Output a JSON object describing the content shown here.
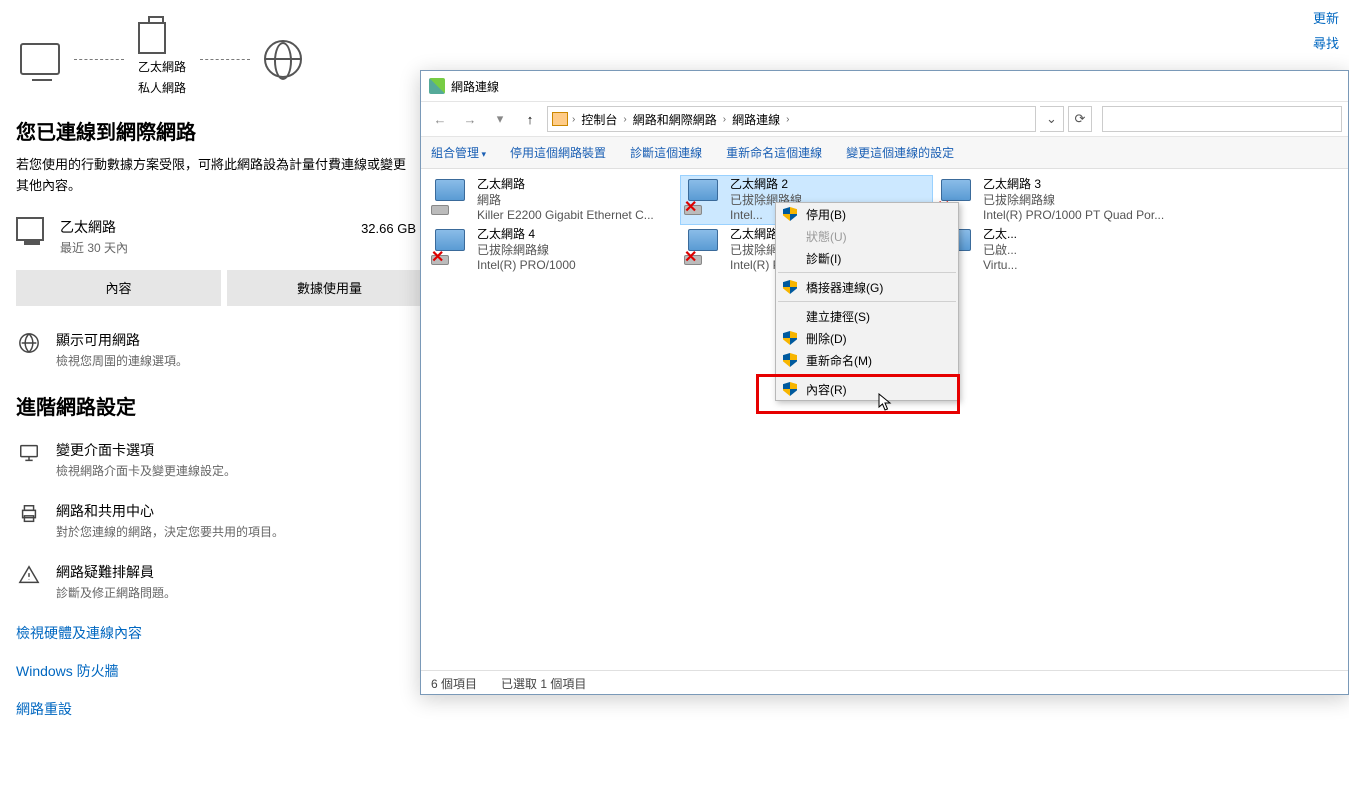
{
  "topLinks": {
    "update": "更新",
    "find": "尋找"
  },
  "diagram": {
    "router_label1": "乙太網路",
    "router_label2": "私人網路"
  },
  "settings": {
    "headline": "您已連線到網際網路",
    "sub": "若您使用的行動數據方案受限，可將此網路設為計量付費連線或變更其他內容。",
    "eth_name": "乙太網路",
    "eth_sub": "最近 30 天內",
    "eth_rate": "32.66 GB",
    "btn_properties": "內容",
    "btn_usage": "數據使用量",
    "opt_available_t": "顯示可用網路",
    "opt_available_s": "檢視您周圍的連線選項。",
    "adv_hdr": "進階網路設定",
    "opt_adapter_t": "變更介面卡選項",
    "opt_adapter_s": "檢視網路介面卡及變更連線設定。",
    "opt_sharing_t": "網路和共用中心",
    "opt_sharing_s": "對於您連線的網路，決定您要共用的項目。",
    "opt_trouble_t": "網路疑難排解員",
    "opt_trouble_s": "診斷及修正網路問題。",
    "link_hw": "檢視硬體及連線內容",
    "link_fw": "Windows 防火牆",
    "link_reset": "網路重設"
  },
  "window": {
    "title": "網路連線",
    "breadcrumb": [
      "控制台",
      "網路和網際網路",
      "網路連線"
    ],
    "toolbar": {
      "org": "組合管理",
      "disable": "停用這個網路裝置",
      "diagnose": "診斷這個連線",
      "rename": "重新命名這個連線",
      "change": "變更這個連線的設定"
    },
    "connections": [
      {
        "name": "乙太網路",
        "status": "網路",
        "device": "Killer E2200 Gigabit Ethernet C...",
        "disconnected": false
      },
      {
        "name": "乙太網路 2",
        "status": "已拔除網路線",
        "device": "Intel...",
        "disconnected": true,
        "selected": true
      },
      {
        "name": "乙太網路 3",
        "status": "已拔除網路線",
        "device": "Intel(R) PRO/1000 PT Quad Por...",
        "disconnected": true
      },
      {
        "name": "乙太網路 4",
        "status": "已拔除網路線",
        "device": "Intel(R) PRO/1000",
        "disconnected": true
      },
      {
        "name": "乙太網路 5",
        "status": "已拔除網路線",
        "device": "Intel(R) PRO/1000 PT Quad Por...",
        "disconnected": true
      },
      {
        "name": "乙太...",
        "status": "已啟...",
        "device": "Virtu...",
        "disconnected": false
      }
    ],
    "status_count": "6 個項目",
    "status_sel": "已選取 1 個項目"
  },
  "contextMenu": {
    "disable": "停用(B)",
    "status": "狀態(U)",
    "diagnose": "診斷(I)",
    "bridge": "橋接器連線(G)",
    "shortcut": "建立捷徑(S)",
    "delete": "刪除(D)",
    "rename": "重新命名(M)",
    "properties": "內容(R)"
  }
}
